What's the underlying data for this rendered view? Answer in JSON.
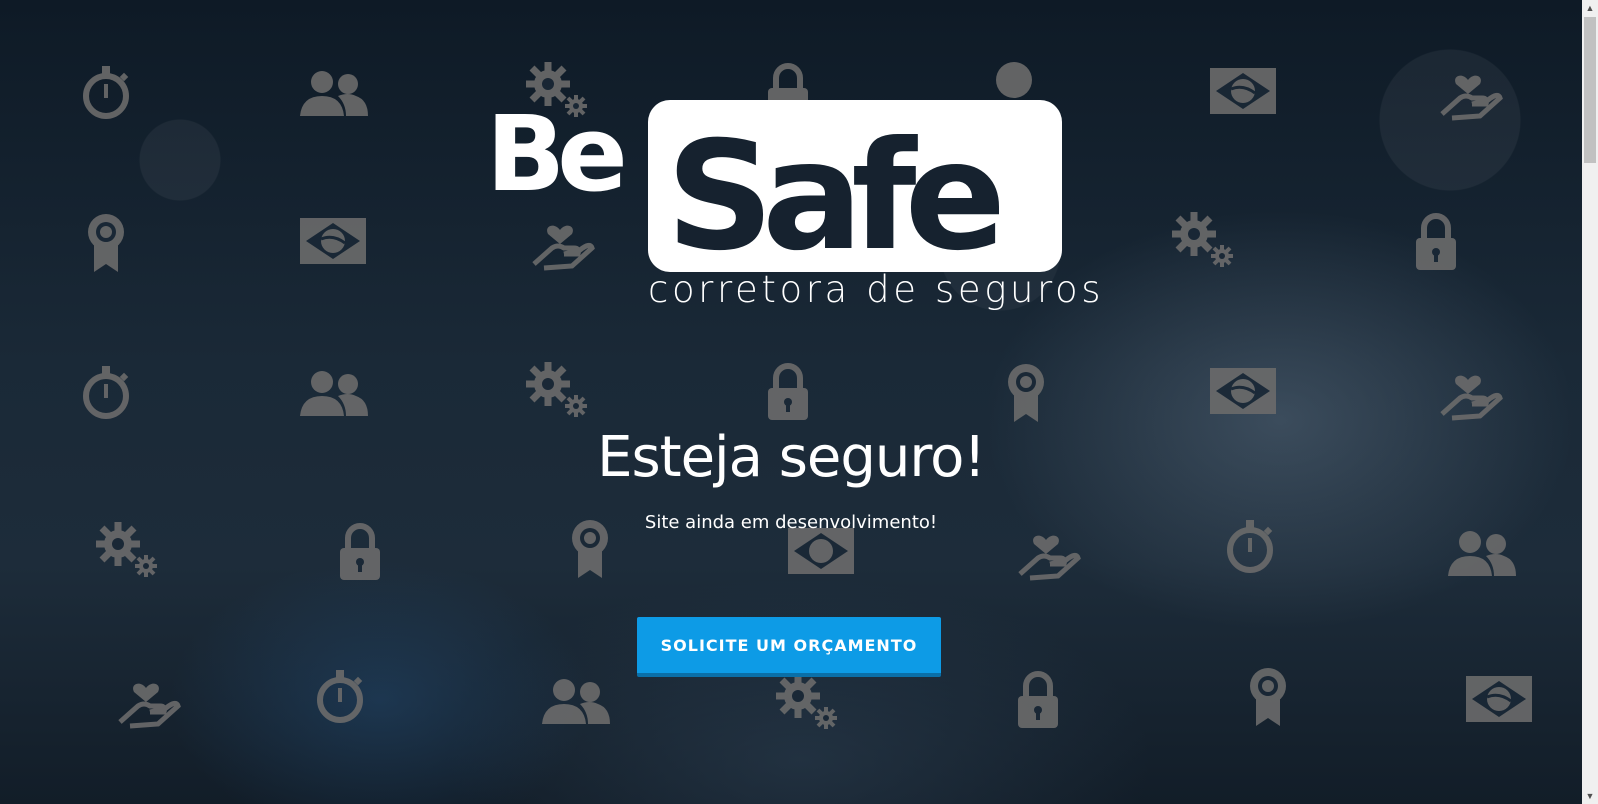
{
  "logo": {
    "be": "Be",
    "safe": "Safe",
    "tagline": "corretora de seguros"
  },
  "hero": {
    "headline": "Esteja seguro!",
    "subtitle": "Site ainda em desenvolvimento!",
    "cta_label": "SOLICITE UM ORÇAMENTO"
  },
  "colors": {
    "accent": "#0d9be6",
    "icon": "#6b6b6b",
    "text": "#ffffff"
  },
  "icons": [
    "stopwatch-icon",
    "users-icon",
    "gears-icon",
    "lock-icon",
    "award-icon",
    "brazil-flag-icon",
    "hand-heart-icon"
  ],
  "scrollbar": {
    "up": "▲",
    "down": "▼"
  }
}
